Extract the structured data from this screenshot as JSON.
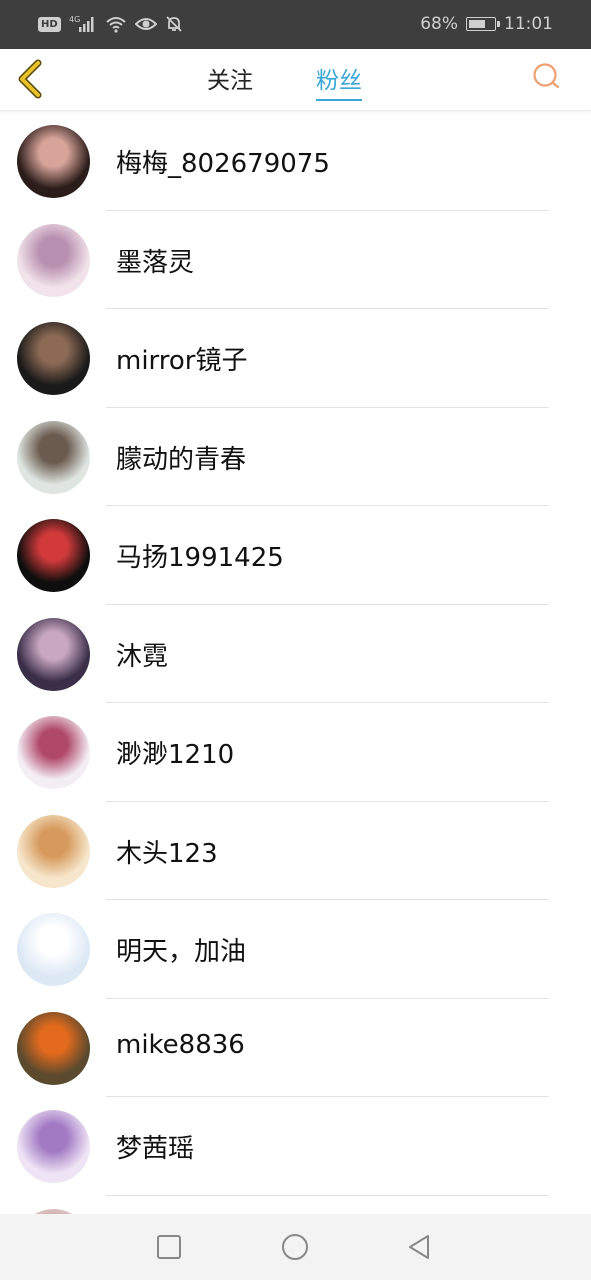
{
  "status_bar": {
    "hd_label": "HD",
    "network_label": "4G",
    "battery_percent": "68%",
    "battery_level": 0.68,
    "time": "11:01",
    "icons": [
      "hd-icon",
      "signal-icon",
      "wifi-icon",
      "eye-icon",
      "mute-bell-icon",
      "battery-icon"
    ]
  },
  "header": {
    "back_icon": "chevron-left-icon",
    "tabs": [
      {
        "label": "关注",
        "active": false
      },
      {
        "label": "粉丝",
        "active": true
      }
    ],
    "search_icon": "search-icon",
    "colors": {
      "active_tab": "#3aa6d8",
      "back_icon": "#e8c229",
      "search_icon": "#f0a070"
    }
  },
  "fans": [
    {
      "name": "梅梅_802679075",
      "avatar_colors": [
        "#2b1d1a",
        "#d8a49a"
      ]
    },
    {
      "name": "墨落灵",
      "avatar_colors": [
        "#f2e3ea",
        "#b78fb0"
      ]
    },
    {
      "name": "mirror镜子",
      "avatar_colors": [
        "#1a1a1a",
        "#8c6a55"
      ]
    },
    {
      "name": "朦动的青春",
      "avatar_colors": [
        "#dfe6e2",
        "#6b5a4e"
      ]
    },
    {
      "name": "马扬1991425",
      "avatar_colors": [
        "#0e0e0e",
        "#d23a3a"
      ]
    },
    {
      "name": "沐霓",
      "avatar_colors": [
        "#3a2e48",
        "#c9a7c2"
      ]
    },
    {
      "name": "渺渺1210",
      "avatar_colors": [
        "#f3eef2",
        "#b0486a"
      ]
    },
    {
      "name": "木头123",
      "avatar_colors": [
        "#f6e7cc",
        "#d79a5c"
      ]
    },
    {
      "name": "明天，加油",
      "avatar_colors": [
        "#dde8f5",
        "#ffffff"
      ]
    },
    {
      "name": "mike8836",
      "avatar_colors": [
        "#5b4a2e",
        "#e36a1d"
      ]
    },
    {
      "name": "梦茜瑶",
      "avatar_colors": [
        "#efe4f5",
        "#a27ac4"
      ]
    },
    {
      "name": "",
      "avatar_colors": [
        "#e8d6d6",
        "#c99a9a"
      ]
    }
  ],
  "nav_bar": {
    "buttons": [
      "recent-apps-icon",
      "home-icon",
      "back-triangle-icon"
    ]
  }
}
